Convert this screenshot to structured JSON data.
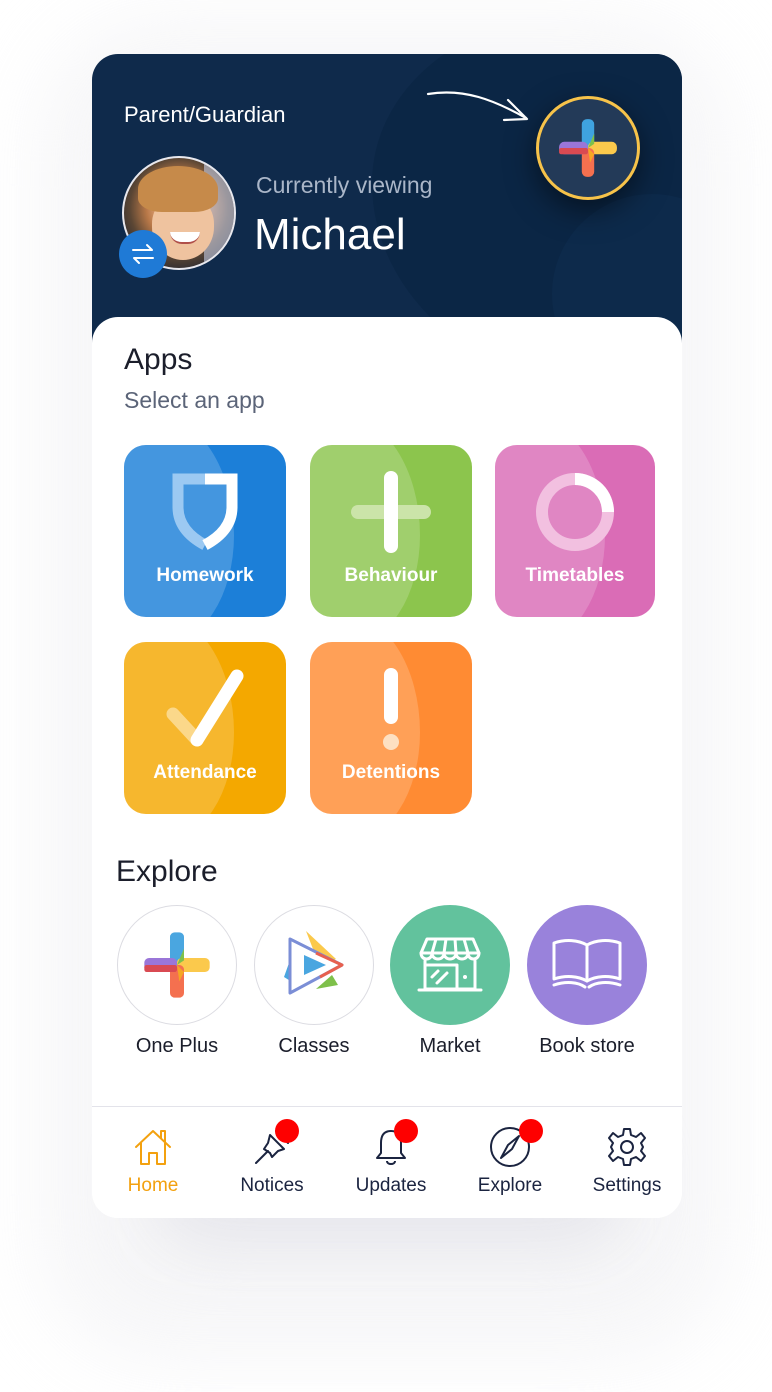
{
  "header": {
    "role_label": "Parent/Guardian",
    "viewing_label": "Currently viewing",
    "child_name": "Michael",
    "switch_icon": "swap-arrows-icon",
    "plus_icon": "one-plus-logo-icon",
    "colors": {
      "background": "#0f2a4b",
      "plus_ring": "#f7c34a",
      "switch": "#1f7ad6"
    }
  },
  "apps": {
    "title": "Apps",
    "subtitle": "Select an app",
    "items": [
      {
        "label": "Homework",
        "icon": "shield-icon",
        "color": "#1c7fd8"
      },
      {
        "label": "Behaviour",
        "icon": "plus-icon",
        "color": "#8cc54d"
      },
      {
        "label": "Timetables",
        "icon": "ring-icon",
        "color": "#da6cb6"
      },
      {
        "label": "Attendance",
        "icon": "check-icon",
        "color": "#f4a800"
      },
      {
        "label": "Detentions",
        "icon": "exclamation-icon",
        "color": "#ff8b33"
      }
    ]
  },
  "explore": {
    "title": "Explore",
    "items": [
      {
        "label": "One Plus",
        "icon": "one-plus-logo-icon"
      },
      {
        "label": "Classes",
        "icon": "play-icon"
      },
      {
        "label": "Market",
        "icon": "storefront-icon",
        "color": "#62c29d"
      },
      {
        "label": "Book store",
        "icon": "open-book-icon",
        "color": "#9982db"
      }
    ]
  },
  "nav": {
    "items": [
      {
        "label": "Home",
        "icon": "home-icon",
        "active": true,
        "badge": false
      },
      {
        "label": "Notices",
        "icon": "pushpin-icon",
        "active": false,
        "badge": true
      },
      {
        "label": "Updates",
        "icon": "bell-icon",
        "active": false,
        "badge": true
      },
      {
        "label": "Explore",
        "icon": "compass-icon",
        "active": false,
        "badge": true
      },
      {
        "label": "Settings",
        "icon": "gear-icon",
        "active": false,
        "badge": false
      }
    ],
    "active_color": "#f3a10f",
    "badge_color": "#fe0000"
  }
}
